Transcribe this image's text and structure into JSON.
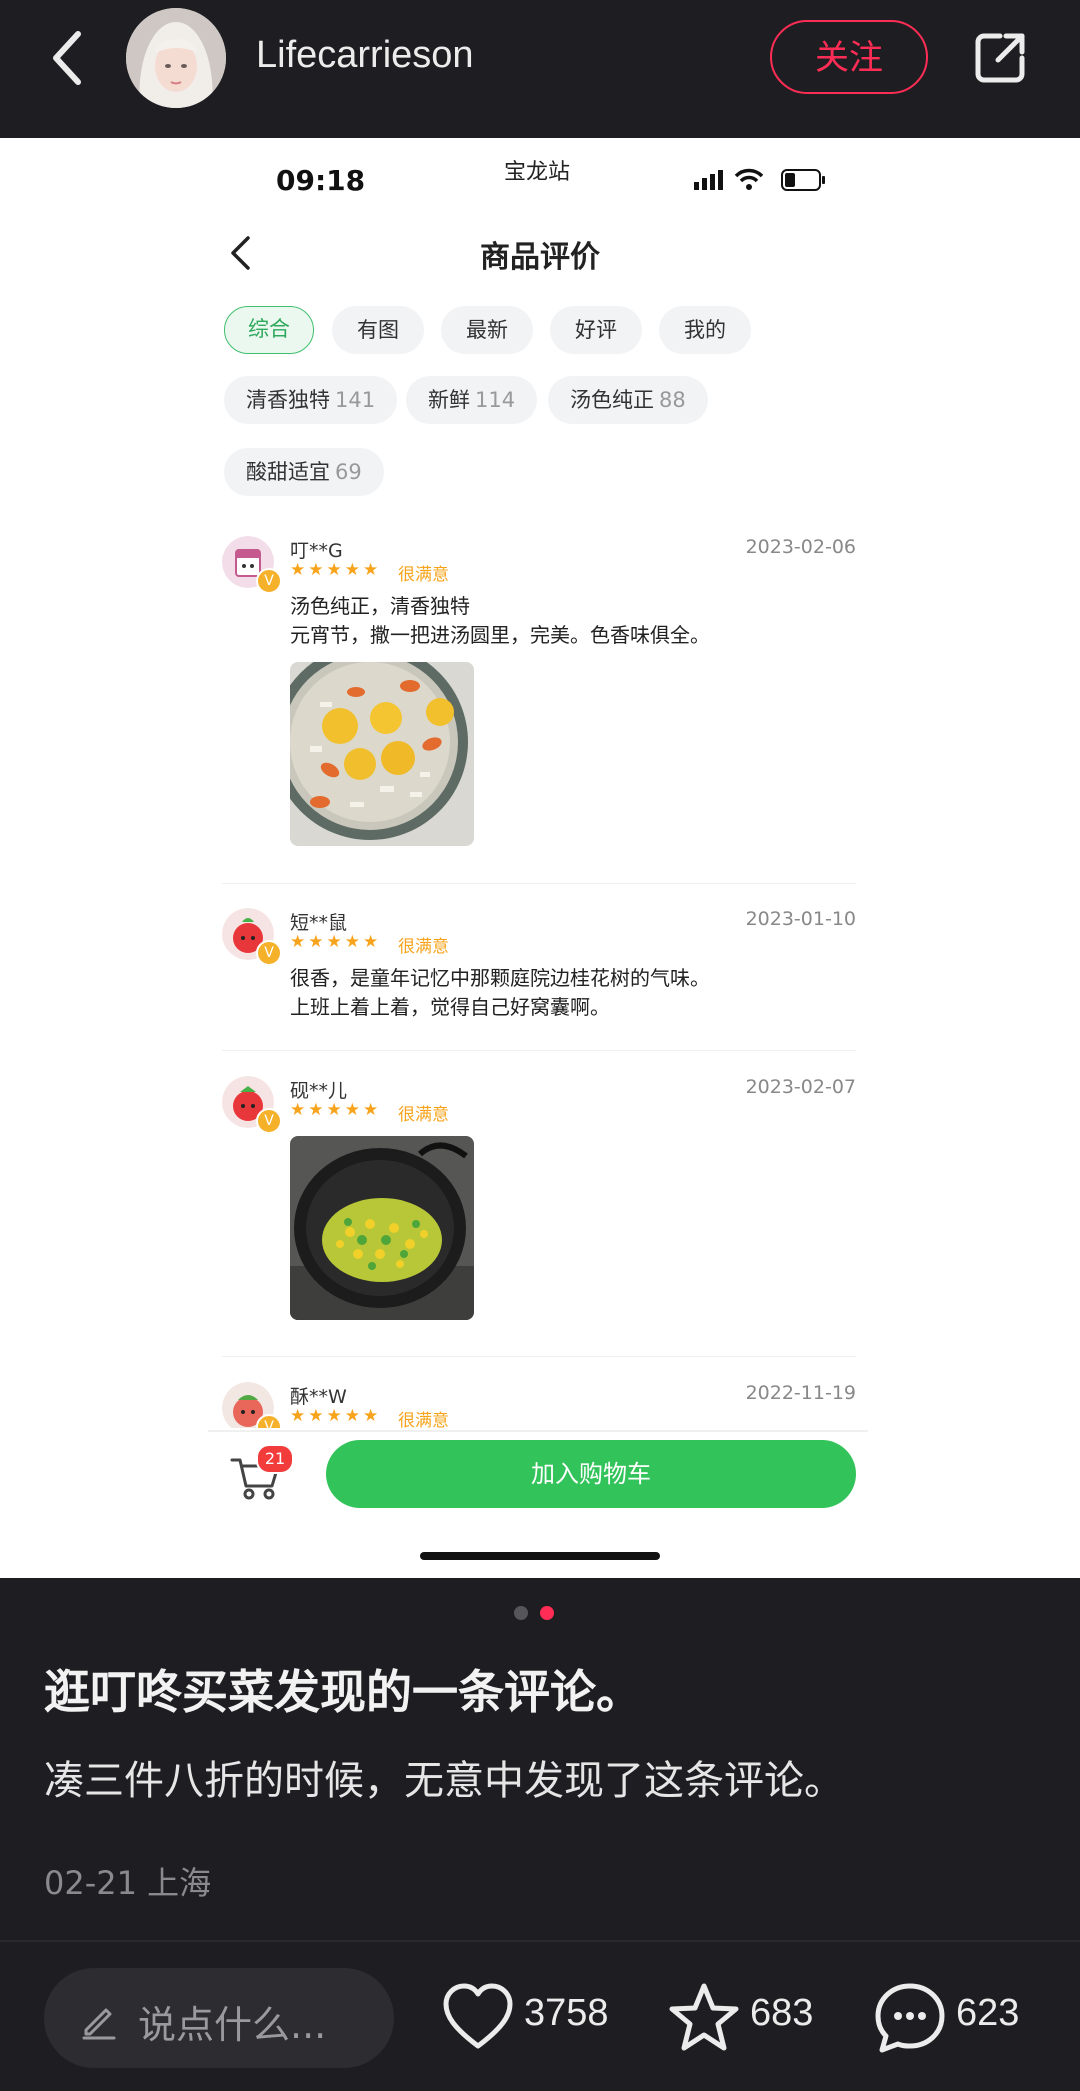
{
  "header": {
    "author": "Lifecarrieson",
    "follow_label": "关注"
  },
  "screenshot": {
    "status": {
      "time": "09:18",
      "station": "宝龙站"
    },
    "page_title": "商品评价",
    "filters": [
      {
        "label": "综合",
        "active": true
      },
      {
        "label": "有图"
      },
      {
        "label": "最新"
      },
      {
        "label": "好评"
      },
      {
        "label": "我的"
      }
    ],
    "tags": [
      {
        "label": "清香独特",
        "count": "141"
      },
      {
        "label": "新鲜",
        "count": "114"
      },
      {
        "label": "汤色纯正",
        "count": "88"
      },
      {
        "label": "酸甜适宜",
        "count": "69"
      }
    ],
    "reviews": [
      {
        "user": "叮**G",
        "date": "2023-02-06",
        "stars": "★★★★★",
        "satisfaction": "很满意",
        "lines": [
          "汤色纯正，清香独特",
          "元宵节，撒一把进汤圆里，完美。色香味俱全。"
        ]
      },
      {
        "user": "短**鼠",
        "date": "2023-01-10",
        "stars": "★★★★★",
        "satisfaction": "很满意",
        "lines": [
          "很香，是童年记忆中那颗庭院边桂花树的气味。",
          "上班上着上着，觉得自己好窝囊啊。"
        ]
      },
      {
        "user": "砚**儿",
        "date": "2023-02-07",
        "stars": "★★★★★",
        "satisfaction": "很满意",
        "lines": []
      },
      {
        "user": "酥**W",
        "date": "2022-11-19",
        "stars": "★★★★★",
        "satisfaction": "很满意",
        "lines": []
      }
    ],
    "cart_badge": "21",
    "add_to_cart": "加入购物车"
  },
  "post": {
    "title": "逛叮咚买菜发现的一条评论。",
    "body": "凑三件八折的时候，无意中发现了这条评论。",
    "meta": "02-21 上海"
  },
  "actions": {
    "comment_placeholder": "说点什么...",
    "likes": "3758",
    "favorites": "683",
    "comments": "623"
  },
  "colors": {
    "accent_red": "#ff2d55",
    "green": "#32c45a",
    "star": "#f7a41c",
    "dark_bg": "#1e1e22"
  }
}
